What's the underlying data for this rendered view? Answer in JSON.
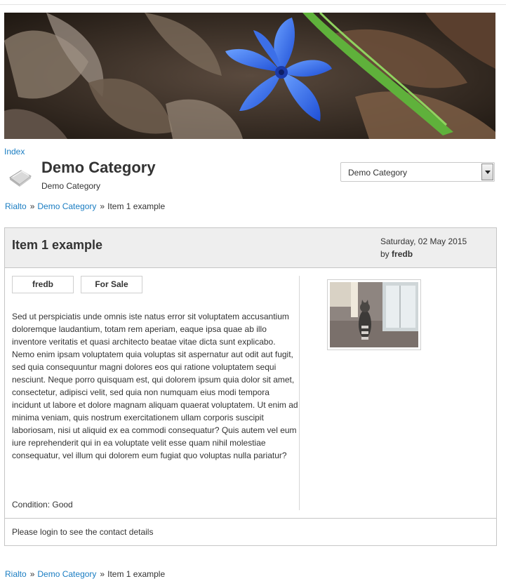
{
  "nav": {
    "index_label": "Index"
  },
  "category": {
    "title": "Demo Category",
    "subtitle": "Demo Category",
    "select_value": "Demo Category"
  },
  "breadcrumb": {
    "root": "Rialto",
    "separator": "»",
    "category": "Demo Category",
    "current": "Item 1 example"
  },
  "item": {
    "title": "Item 1 example",
    "date": "Saturday, 02 May 2015",
    "by_prefix": "by",
    "author": "fredb",
    "tags": [
      "fredb",
      "For Sale"
    ],
    "description": "Sed ut perspiciatis unde omnis iste natus error sit voluptatem accusantium doloremque laudantium, totam rem aperiam, eaque ipsa quae ab illo inventore veritatis et quasi architecto beatae vitae dicta sunt explicabo. Nemo enim ipsam voluptatem quia voluptas sit aspernatur aut odit aut fugit, sed quia consequuntur magni dolores eos qui ratione voluptatem sequi nesciunt. Neque porro quisquam est, qui dolorem ipsum quia dolor sit amet, consectetur, adipisci velit, sed quia non numquam eius modi tempora incidunt ut labore et dolore magnam aliquam quaerat voluptatem. Ut enim ad minima veniam, quis nostrum exercitationem ullam corporis suscipit laboriosam, nisi ut aliquid ex ea commodi consequatur? Quis autem vel eum iure reprehenderit qui in ea voluptate velit esse quam nihil molestiae consequatur, vel illum qui dolorem eum fugiat quo voluptas nulla pariatur?",
    "condition": "Condition: Good",
    "login_note": "Please login to see the contact details"
  },
  "icons": {
    "category": "category-book-icon",
    "select_arrow": "chevron-down-icon"
  },
  "colors": {
    "link": "#1a7dc2",
    "panel_header": "#eeeeee",
    "border": "#c6c6c6"
  }
}
